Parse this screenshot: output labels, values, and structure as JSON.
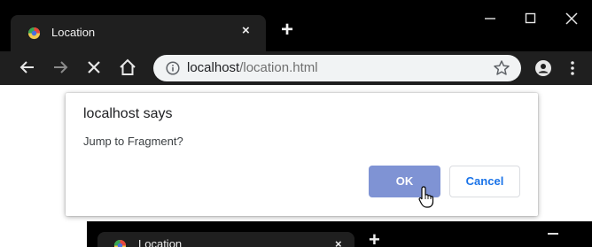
{
  "browser": {
    "tab": {
      "title": "Location",
      "favicon": "chrome-favicon",
      "close_glyph": "×"
    },
    "new_tab_glyph": "+",
    "window_controls": [
      "minimize-icon",
      "maximize-icon",
      "close-icon"
    ],
    "toolbar": {
      "icons": [
        "back-arrow-icon",
        "forward-arrow-icon",
        "stop-icon",
        "home-icon",
        "info-icon",
        "star-icon",
        "account-icon",
        "menu-icon"
      ],
      "url_host": "localhost",
      "url_path": "/location.html"
    }
  },
  "dialog": {
    "title": "localhost says",
    "message": "Jump to Fragment?",
    "ok_label": "OK",
    "cancel_label": "Cancel"
  },
  "background_window": {
    "tab_title": "Location",
    "close_glyph": "×",
    "new_tab_glyph": "+"
  },
  "colors": {
    "titlebar": "#000000",
    "toolbar": "#1f1f1f",
    "omnibox": "#f1f3f4",
    "ok_button": "#7f93d4",
    "cancel_text": "#1a73e8"
  }
}
